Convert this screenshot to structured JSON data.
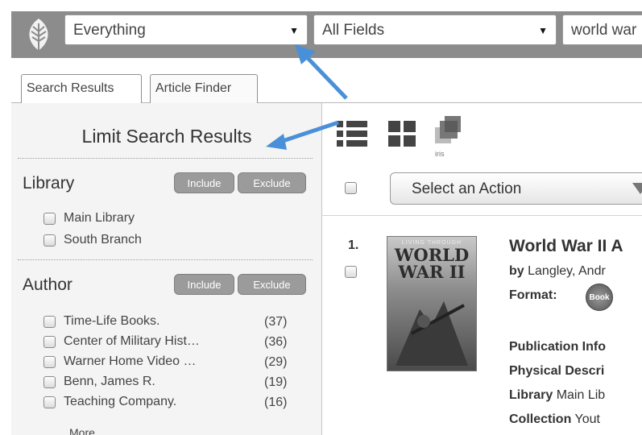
{
  "search_bar": {
    "scope_value": "Everything",
    "field_value": "All Fields",
    "query_value": "world war"
  },
  "tabs": [
    {
      "label": "Search Results"
    },
    {
      "label": "Article Finder"
    }
  ],
  "limit": {
    "title": "Limit Search Results",
    "facets": [
      {
        "title": "Library",
        "include_label": "Include",
        "exclude_label": "Exclude",
        "items": [
          {
            "label": "Main Library"
          },
          {
            "label": "South Branch"
          }
        ]
      },
      {
        "title": "Author",
        "include_label": "Include",
        "exclude_label": "Exclude",
        "items": [
          {
            "label": "Time-Life Books.",
            "count": "(37)"
          },
          {
            "label": "Center of Military Hist…",
            "count": "(36)"
          },
          {
            "label": "Warner Home Video …",
            "count": "(29)"
          },
          {
            "label": "Benn, James R.",
            "count": "(19)"
          },
          {
            "label": "Teaching Company.",
            "count": "(16)"
          }
        ],
        "more_label": "More..."
      }
    ]
  },
  "toolbar": {
    "iris_label": "iris",
    "action_label": "Select an Action"
  },
  "result": {
    "number": "1.",
    "title": "World War II A",
    "by_label": "by",
    "author": "Langley, Andr",
    "format_label": "Format:",
    "format_badge": "Book",
    "cover_small": "LIVING THROUGH",
    "cover_title": "WORLD WAR II",
    "fields": [
      {
        "label": "Publication Info",
        "value": ""
      },
      {
        "label": "Physical Descri",
        "value": ""
      },
      {
        "label": "Library",
        "value": "Main Lib"
      },
      {
        "label": "Collection",
        "value": "Yout"
      }
    ]
  },
  "colors": {
    "topbar": "#8c8c8c",
    "arrow": "#4a90d9",
    "pill": "#9b9b9b",
    "panel": "#f4f4f4"
  },
  "icons": [
    "leaf-logo-icon",
    "list-view-icon",
    "grid-view-icon",
    "iris-view-icon",
    "book-format-icon"
  ]
}
